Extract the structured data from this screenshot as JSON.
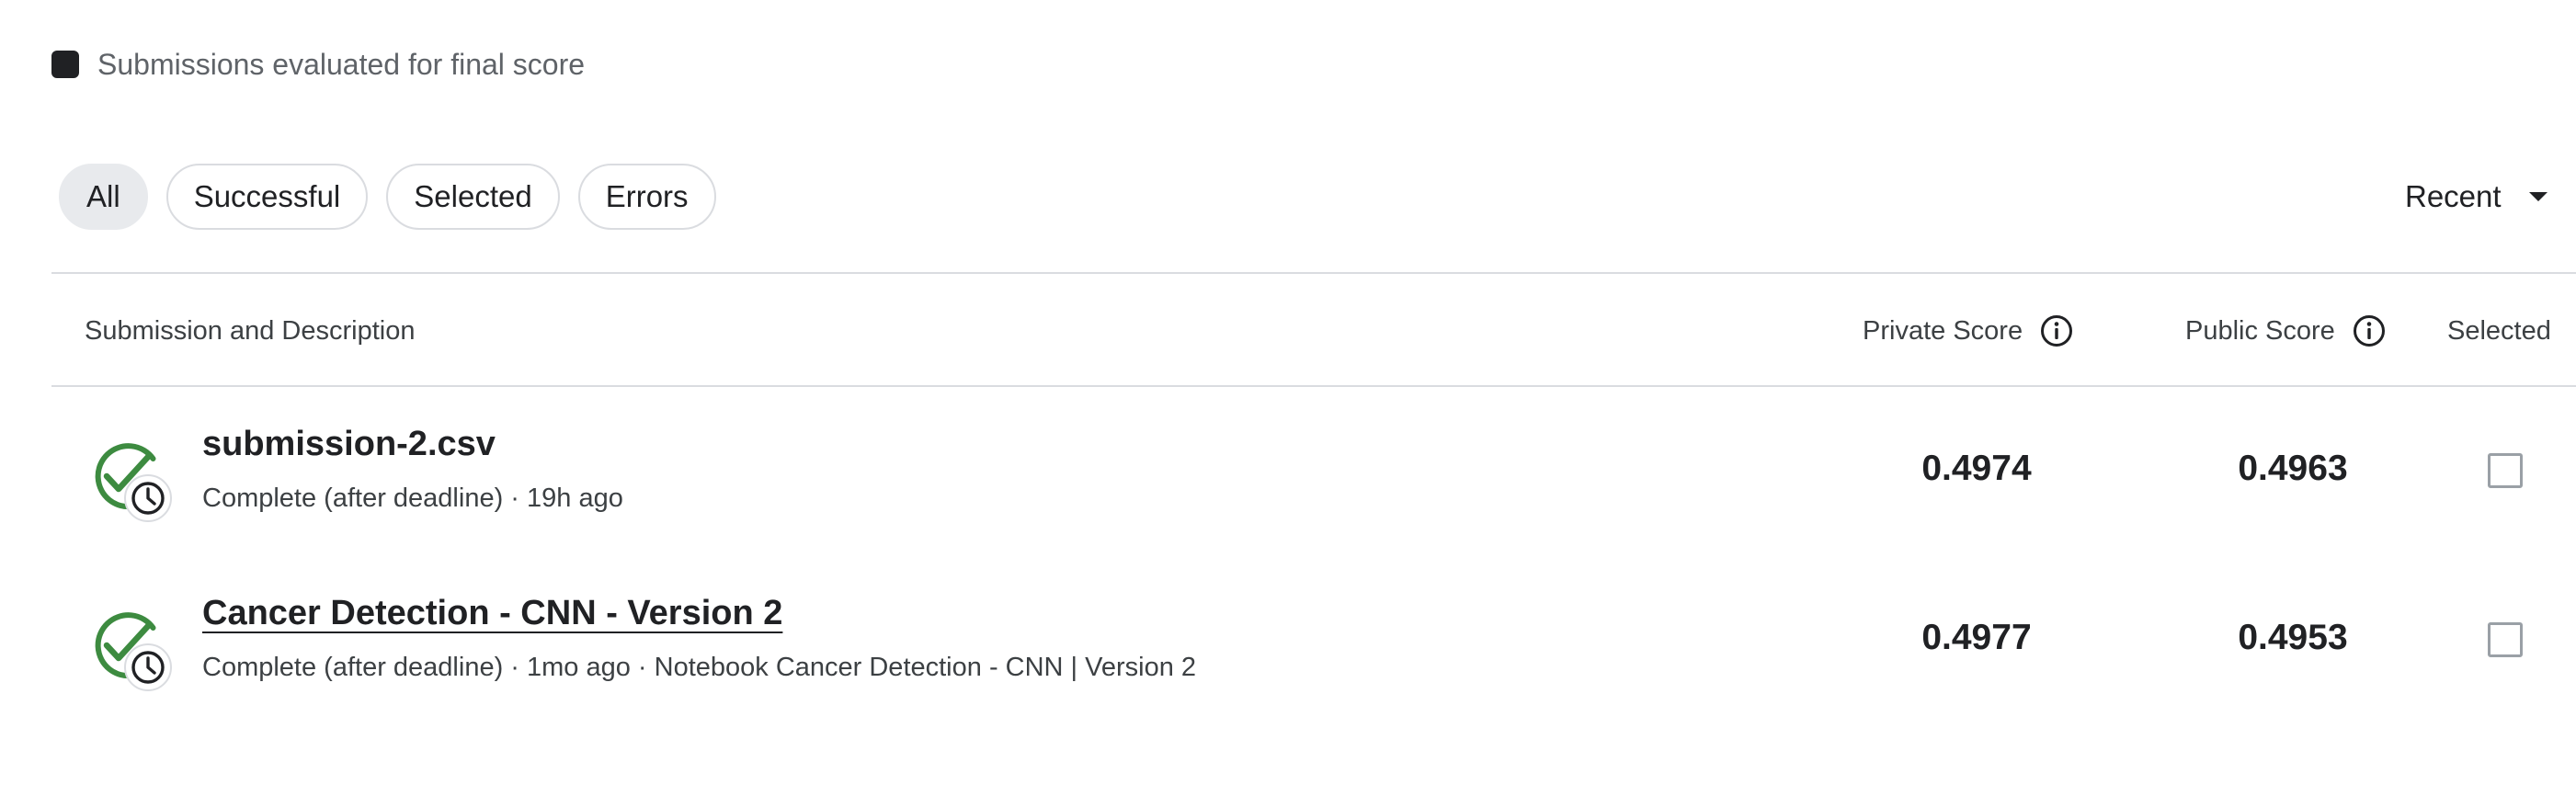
{
  "legend": {
    "label": "Submissions evaluated for final score"
  },
  "filters": [
    {
      "label": "All",
      "active": true
    },
    {
      "label": "Successful",
      "active": false
    },
    {
      "label": "Selected",
      "active": false
    },
    {
      "label": "Errors",
      "active": false
    }
  ],
  "sort": {
    "label": "Recent",
    "icon": "caret-down-icon"
  },
  "table": {
    "columns": {
      "submission": "Submission and Description",
      "private_score": "Private Score",
      "public_score": "Public Score",
      "selected": "Selected"
    },
    "rows": [
      {
        "title": "submission-2.csv",
        "meta": "Complete (after deadline) · 19h ago",
        "private_score": "0.4974",
        "public_score": "0.4963",
        "selected": false,
        "status_icon": "complete-late-icon"
      },
      {
        "title": "Cancer Detection - CNN - Version 2",
        "meta": "Complete (after deadline) · 1mo ago · Notebook Cancer Detection - CNN | Version 2",
        "private_score": "0.4977",
        "public_score": "0.4953",
        "selected": false,
        "status_icon": "complete-late-icon"
      }
    ]
  },
  "colors": {
    "success_green": "#3d8b40",
    "text_primary": "#202124",
    "text_secondary": "#5f6368",
    "divider": "#dadce0",
    "chip_active_bg": "#e8eaed"
  }
}
